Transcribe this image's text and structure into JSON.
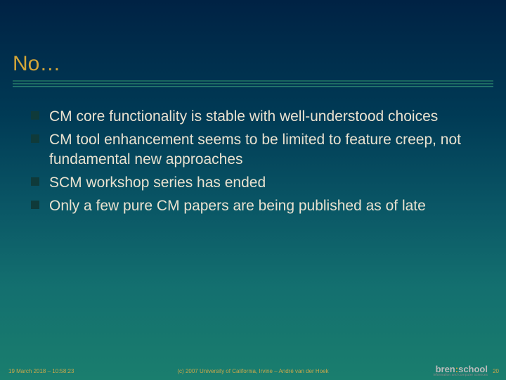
{
  "slide": {
    "title": "No…",
    "bullets": [
      "CM core functionality is stable with well-understood choices",
      "CM tool enhancement seems to be limited to feature creep, not fundamental new approaches",
      "SCM workshop series has ended",
      "Only a few pure CM papers are being published as of late"
    ]
  },
  "footer": {
    "timestamp": "19 March 2018 – 10:58:23",
    "copyright": "(c) 2007 University of California, Irvine – André van der Hoek",
    "slide_number": "20",
    "logo_main_a": "bren",
    "logo_main_b": ":",
    "logo_main_c": "school",
    "logo_sub": "information and computer sciences"
  }
}
